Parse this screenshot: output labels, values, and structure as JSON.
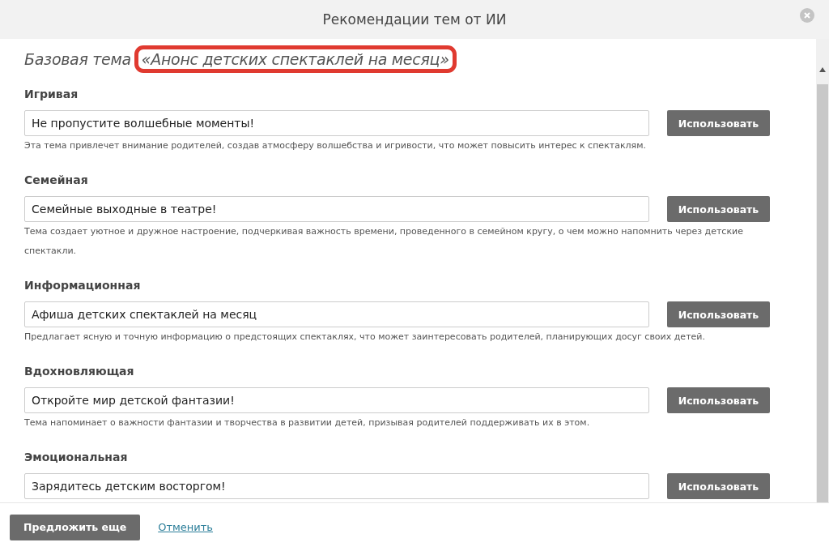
{
  "window": {
    "title": "Рекомендации тем от ИИ"
  },
  "base_theme": {
    "label": "Базовая тема",
    "value": "«Анонс детских спектаклей на месяц»"
  },
  "suggestions": [
    {
      "category": "Игривая",
      "value": "Не пропустите волшебные моменты!",
      "button": "Использовать",
      "description": "Эта тема привлечет внимание родителей, создав атмосферу волшебства и игривости, что может повысить интерес к спектаклям."
    },
    {
      "category": "Семейная",
      "value": "Семейные выходные в театре!",
      "button": "Использовать",
      "description": "Тема создает уютное и дружное настроение, подчеркивая важность времени, проведенного в семейном кругу, о чем можно напомнить через детские спектакли."
    },
    {
      "category": "Информационная",
      "value": "Афиша детских спектаклей на месяц",
      "button": "Использовать",
      "description": "Предлагает ясную и точную информацию о предстоящих спектаклях, что может заинтересовать родителей, планирующих досуг своих детей."
    },
    {
      "category": "Вдохновляющая",
      "value": "Откройте мир детской фантазии!",
      "button": "Использовать",
      "description": "Тема напоминает о важности фантазии и творчества в развитии детей, призывая родителей поддерживать их в этом."
    },
    {
      "category": "Эмоциональная",
      "value": "Зарядитесь детским восторгом!",
      "button": "Использовать"
    }
  ],
  "footer": {
    "primary_button": "Предложить еще",
    "cancel_link": "Отменить"
  }
}
